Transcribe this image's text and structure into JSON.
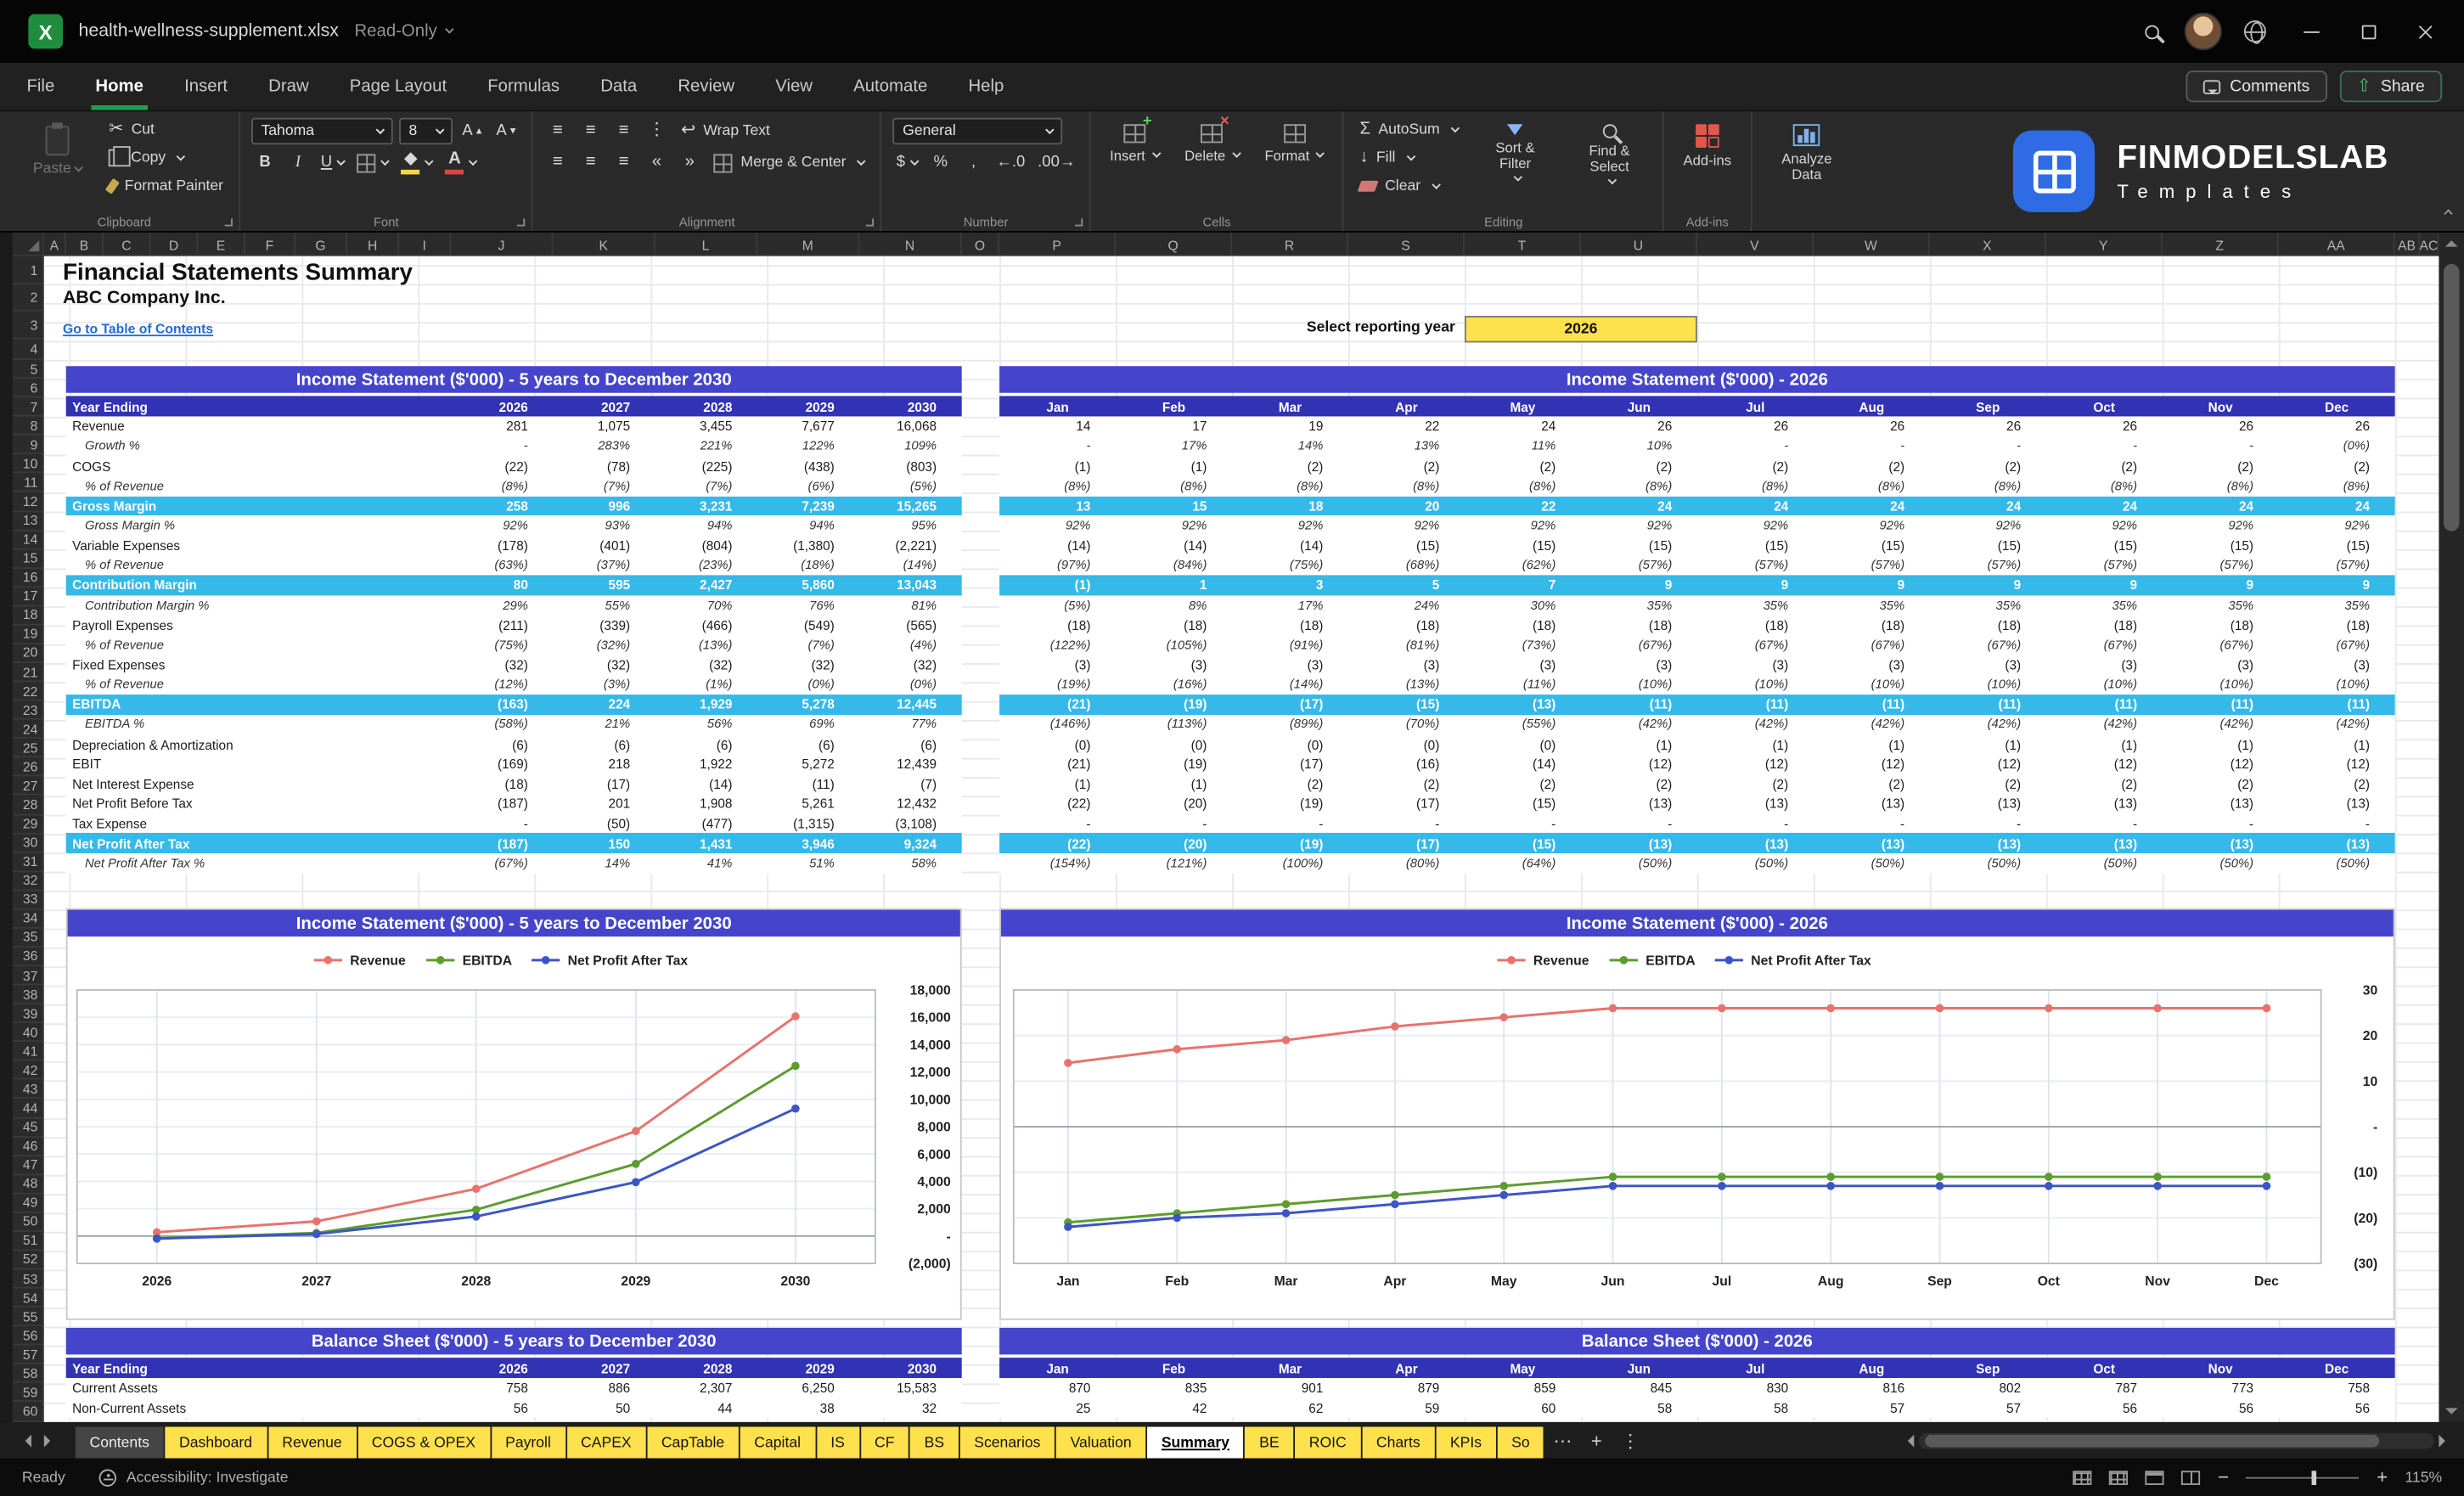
{
  "titlebar": {
    "filename": "health-wellness-supplement.xlsx",
    "mode": "Read-Only"
  },
  "menubar": {
    "items": [
      "File",
      "Home",
      "Insert",
      "Draw",
      "Page Layout",
      "Formulas",
      "Data",
      "Review",
      "View",
      "Automate",
      "Help"
    ],
    "active_item": "Home",
    "comments_label": "Comments",
    "share_label": "Share"
  },
  "ribbon": {
    "clipboard": {
      "label": "Clipboard",
      "paste": "Paste",
      "cut": "Cut",
      "copy": "Copy",
      "format_painter": "Format Painter"
    },
    "font": {
      "label": "Font",
      "font_name": "Tahoma",
      "font_size": "8"
    },
    "alignment": {
      "label": "Alignment",
      "wrap_text": "Wrap Text",
      "merge_center": "Merge & Center"
    },
    "number": {
      "label": "Number",
      "format": "General"
    },
    "cells": {
      "label": "Cells",
      "insert": "Insert",
      "delete": "Delete",
      "format": "Format"
    },
    "editing": {
      "label": "Editing",
      "autosum": "AutoSum",
      "fill": "Fill",
      "clear": "Clear",
      "sort_filter": "Sort & Filter",
      "find_select": "Find & Select"
    },
    "addins": {
      "label": "Add-ins",
      "button": "Add-ins"
    },
    "analyze": {
      "label": "Analyze Data"
    },
    "logo": {
      "line1": "FINMODELSLAB",
      "line2": "Templates"
    }
  },
  "grid": {
    "columns": [
      "A",
      "B",
      "C",
      "D",
      "E",
      "F",
      "G",
      "H",
      "I",
      "J",
      "K",
      "L",
      "M",
      "N",
      "O",
      "P",
      "Q",
      "R",
      "S",
      "T",
      "U",
      "V",
      "W",
      "X",
      "Y",
      "Z",
      "AA",
      "AB",
      "AC"
    ],
    "row_count": 60
  },
  "page": {
    "title": "Financial Statements Summary",
    "company": "ABC Company Inc.",
    "toc_link": "Go to Table of Contents",
    "reporting_year_label": "Select reporting year",
    "reporting_year": "2026"
  },
  "colors": {
    "accent_green": "#1f9e54",
    "header_bar": "#4545cb",
    "table_header": "#3232b4",
    "section_row": "#35b9e9",
    "tab_yellow": "#ffe14d",
    "link_blue": "#1f6bd8",
    "year_cell": "#ffe14d"
  },
  "income_statement": {
    "left_title": "Income Statement ($'000) - 5 years to December 2030",
    "right_title": "Income Statement ($'000) - 2026",
    "row_header": "Year Ending",
    "years": [
      "2026",
      "2027",
      "2028",
      "2029",
      "2030"
    ],
    "months": [
      "Jan",
      "Feb",
      "Mar",
      "Apr",
      "May",
      "Jun",
      "Jul",
      "Aug",
      "Sep",
      "Oct",
      "Nov",
      "Dec"
    ],
    "rows": [
      {
        "label": "Revenue",
        "style": "n",
        "years": [
          "281",
          "1,075",
          "3,455",
          "7,677",
          "16,068"
        ],
        "months": [
          "14",
          "17",
          "19",
          "22",
          "24",
          "26",
          "26",
          "26",
          "26",
          "26",
          "26",
          "26"
        ]
      },
      {
        "label": "Growth %",
        "style": "i",
        "years": [
          "-",
          "283%",
          "221%",
          "122%",
          "109%"
        ],
        "months": [
          "-",
          "17%",
          "14%",
          "13%",
          "11%",
          "10%",
          "-",
          "-",
          "-",
          "-",
          "-",
          "(0%)"
        ]
      },
      {
        "label": "COGS",
        "style": "n",
        "years": [
          "(22)",
          "(78)",
          "(225)",
          "(438)",
          "(803)"
        ],
        "months": [
          "(1)",
          "(1)",
          "(2)",
          "(2)",
          "(2)",
          "(2)",
          "(2)",
          "(2)",
          "(2)",
          "(2)",
          "(2)",
          "(2)"
        ]
      },
      {
        "label": "% of Revenue",
        "style": "i",
        "years": [
          "(8%)",
          "(7%)",
          "(7%)",
          "(6%)",
          "(5%)"
        ],
        "months": [
          "(8%)",
          "(8%)",
          "(8%)",
          "(8%)",
          "(8%)",
          "(8%)",
          "(8%)",
          "(8%)",
          "(8%)",
          "(8%)",
          "(8%)",
          "(8%)"
        ]
      },
      {
        "label": "Gross Margin",
        "style": "s",
        "years": [
          "258",
          "996",
          "3,231",
          "7,239",
          "15,265"
        ],
        "months": [
          "13",
          "15",
          "18",
          "20",
          "22",
          "24",
          "24",
          "24",
          "24",
          "24",
          "24",
          "24"
        ]
      },
      {
        "label": "Gross Margin %",
        "style": "i",
        "years": [
          "92%",
          "93%",
          "94%",
          "94%",
          "95%"
        ],
        "months": [
          "92%",
          "92%",
          "92%",
          "92%",
          "92%",
          "92%",
          "92%",
          "92%",
          "92%",
          "92%",
          "92%",
          "92%"
        ]
      },
      {
        "label": "Variable Expenses",
        "style": "n",
        "years": [
          "(178)",
          "(401)",
          "(804)",
          "(1,380)",
          "(2,221)"
        ],
        "months": [
          "(14)",
          "(14)",
          "(14)",
          "(15)",
          "(15)",
          "(15)",
          "(15)",
          "(15)",
          "(15)",
          "(15)",
          "(15)",
          "(15)"
        ]
      },
      {
        "label": "% of Revenue",
        "style": "i",
        "years": [
          "(63%)",
          "(37%)",
          "(23%)",
          "(18%)",
          "(14%)"
        ],
        "months": [
          "(97%)",
          "(84%)",
          "(75%)",
          "(68%)",
          "(62%)",
          "(57%)",
          "(57%)",
          "(57%)",
          "(57%)",
          "(57%)",
          "(57%)",
          "(57%)"
        ]
      },
      {
        "label": "Contribution Margin",
        "style": "s",
        "years": [
          "80",
          "595",
          "2,427",
          "5,860",
          "13,043"
        ],
        "months": [
          "(1)",
          "1",
          "3",
          "5",
          "7",
          "9",
          "9",
          "9",
          "9",
          "9",
          "9",
          "9"
        ]
      },
      {
        "label": "Contribution Margin %",
        "style": "i",
        "years": [
          "29%",
          "55%",
          "70%",
          "76%",
          "81%"
        ],
        "months": [
          "(5%)",
          "8%",
          "17%",
          "24%",
          "30%",
          "35%",
          "35%",
          "35%",
          "35%",
          "35%",
          "35%",
          "35%"
        ]
      },
      {
        "label": "Payroll Expenses",
        "style": "n",
        "years": [
          "(211)",
          "(339)",
          "(466)",
          "(549)",
          "(565)"
        ],
        "months": [
          "(18)",
          "(18)",
          "(18)",
          "(18)",
          "(18)",
          "(18)",
          "(18)",
          "(18)",
          "(18)",
          "(18)",
          "(18)",
          "(18)"
        ]
      },
      {
        "label": "% of Revenue",
        "style": "i",
        "years": [
          "(75%)",
          "(32%)",
          "(13%)",
          "(7%)",
          "(4%)"
        ],
        "months": [
          "(122%)",
          "(105%)",
          "(91%)",
          "(81%)",
          "(73%)",
          "(67%)",
          "(67%)",
          "(67%)",
          "(67%)",
          "(67%)",
          "(67%)",
          "(67%)"
        ]
      },
      {
        "label": "Fixed Expenses",
        "style": "n",
        "years": [
          "(32)",
          "(32)",
          "(32)",
          "(32)",
          "(32)"
        ],
        "months": [
          "(3)",
          "(3)",
          "(3)",
          "(3)",
          "(3)",
          "(3)",
          "(3)",
          "(3)",
          "(3)",
          "(3)",
          "(3)",
          "(3)"
        ]
      },
      {
        "label": "% of Revenue",
        "style": "i",
        "years": [
          "(12%)",
          "(3%)",
          "(1%)",
          "(0%)",
          "(0%)"
        ],
        "months": [
          "(19%)",
          "(16%)",
          "(14%)",
          "(13%)",
          "(11%)",
          "(10%)",
          "(10%)",
          "(10%)",
          "(10%)",
          "(10%)",
          "(10%)",
          "(10%)"
        ]
      },
      {
        "label": "EBITDA",
        "style": "s",
        "years": [
          "(163)",
          "224",
          "1,929",
          "5,278",
          "12,445"
        ],
        "months": [
          "(21)",
          "(19)",
          "(17)",
          "(15)",
          "(13)",
          "(11)",
          "(11)",
          "(11)",
          "(11)",
          "(11)",
          "(11)",
          "(11)"
        ]
      },
      {
        "label": "EBITDA %",
        "style": "i",
        "years": [
          "(58%)",
          "21%",
          "56%",
          "69%",
          "77%"
        ],
        "months": [
          "(146%)",
          "(113%)",
          "(89%)",
          "(70%)",
          "(55%)",
          "(42%)",
          "(42%)",
          "(42%)",
          "(42%)",
          "(42%)",
          "(42%)",
          "(42%)"
        ]
      },
      {
        "label": "Depreciation & Amortization",
        "style": "n",
        "years": [
          "(6)",
          "(6)",
          "(6)",
          "(6)",
          "(6)"
        ],
        "months": [
          "(0)",
          "(0)",
          "(0)",
          "(0)",
          "(0)",
          "(1)",
          "(1)",
          "(1)",
          "(1)",
          "(1)",
          "(1)",
          "(1)"
        ]
      },
      {
        "label": "EBIT",
        "style": "n",
        "years": [
          "(169)",
          "218",
          "1,922",
          "5,272",
          "12,439"
        ],
        "months": [
          "(21)",
          "(19)",
          "(17)",
          "(16)",
          "(14)",
          "(12)",
          "(12)",
          "(12)",
          "(12)",
          "(12)",
          "(12)",
          "(12)"
        ]
      },
      {
        "label": "Net Interest Expense",
        "style": "n",
        "years": [
          "(18)",
          "(17)",
          "(14)",
          "(11)",
          "(7)"
        ],
        "months": [
          "(1)",
          "(1)",
          "(2)",
          "(2)",
          "(2)",
          "(2)",
          "(2)",
          "(2)",
          "(2)",
          "(2)",
          "(2)",
          "(2)"
        ]
      },
      {
        "label": "Net Profit Before Tax",
        "style": "n",
        "years": [
          "(187)",
          "201",
          "1,908",
          "5,261",
          "12,432"
        ],
        "months": [
          "(22)",
          "(20)",
          "(19)",
          "(17)",
          "(15)",
          "(13)",
          "(13)",
          "(13)",
          "(13)",
          "(13)",
          "(13)",
          "(13)"
        ]
      },
      {
        "label": "Tax Expense",
        "style": "n",
        "years": [
          "-",
          "(50)",
          "(477)",
          "(1,315)",
          "(3,108)"
        ],
        "months": [
          "-",
          "-",
          "-",
          "-",
          "-",
          "-",
          "-",
          "-",
          "-",
          "-",
          "-",
          "-"
        ]
      },
      {
        "label": "Net Profit After Tax",
        "style": "s",
        "years": [
          "(187)",
          "150",
          "1,431",
          "3,946",
          "9,324"
        ],
        "months": [
          "(22)",
          "(20)",
          "(19)",
          "(17)",
          "(15)",
          "(13)",
          "(13)",
          "(13)",
          "(13)",
          "(13)",
          "(13)",
          "(13)"
        ]
      },
      {
        "label": "Net Profit After Tax %",
        "style": "i",
        "years": [
          "(67%)",
          "14%",
          "41%",
          "51%",
          "58%"
        ],
        "months": [
          "(154%)",
          "(121%)",
          "(100%)",
          "(80%)",
          "(64%)",
          "(50%)",
          "(50%)",
          "(50%)",
          "(50%)",
          "(50%)",
          "(50%)",
          "(50%)"
        ]
      }
    ]
  },
  "balance_sheet": {
    "left_title": "Balance Sheet ($'000) - 5 years to December 2030",
    "right_title": "Balance Sheet ($'000) - 2026",
    "row_header": "Year Ending",
    "rows": [
      {
        "label": "Current Assets",
        "style": "n",
        "years": [
          "758",
          "886",
          "2,307",
          "6,250",
          "15,583"
        ],
        "months": [
          "870",
          "835",
          "901",
          "879",
          "859",
          "845",
          "830",
          "816",
          "802",
          "787",
          "773",
          "758"
        ]
      },
      {
        "label": "Non-Current Assets",
        "style": "n",
        "years": [
          "56",
          "50",
          "44",
          "38",
          "32"
        ],
        "months": [
          "25",
          "42",
          "62",
          "59",
          "60",
          "58",
          "58",
          "57",
          "57",
          "56",
          "56",
          "56"
        ]
      }
    ]
  },
  "chart_data": [
    {
      "type": "line",
      "title": "Income Statement ($'000) - 5 years to December 2030",
      "x": [
        "2026",
        "2027",
        "2028",
        "2029",
        "2030"
      ],
      "series": [
        {
          "name": "Revenue",
          "color": "#e8736e",
          "values": [
            281,
            1075,
            3455,
            7677,
            16068
          ]
        },
        {
          "name": "EBITDA",
          "color": "#5e9c2f",
          "values": [
            -163,
            224,
            1929,
            5278,
            12445
          ]
        },
        {
          "name": "Net Profit After Tax",
          "color": "#3c55c6",
          "values": [
            -187,
            150,
            1431,
            3946,
            9324
          ]
        }
      ],
      "ylim": [
        -2000,
        18000
      ],
      "ytick_labels": [
        "18,000",
        "16,000",
        "14,000",
        "12,000",
        "10,000",
        "8,000",
        "6,000",
        "4,000",
        "2,000",
        "-",
        "(2,000)"
      ],
      "legend_position": "top",
      "axis_side": "right",
      "grid": true
    },
    {
      "type": "line",
      "title": "Income Statement ($'000) - 2026",
      "x": [
        "Jan",
        "Feb",
        "Mar",
        "Apr",
        "May",
        "Jun",
        "Jul",
        "Aug",
        "Sep",
        "Oct",
        "Nov",
        "Dec"
      ],
      "series": [
        {
          "name": "Revenue",
          "color": "#e8736e",
          "values": [
            14,
            17,
            19,
            22,
            24,
            26,
            26,
            26,
            26,
            26,
            26,
            26
          ]
        },
        {
          "name": "EBITDA",
          "color": "#5e9c2f",
          "values": [
            -21,
            -19,
            -17,
            -15,
            -13,
            -11,
            -11,
            -11,
            -11,
            -11,
            -11,
            -11
          ]
        },
        {
          "name": "Net Profit After Tax",
          "color": "#3c55c6",
          "values": [
            -22,
            -20,
            -19,
            -17,
            -15,
            -13,
            -13,
            -13,
            -13,
            -13,
            -13,
            -13
          ]
        }
      ],
      "ylim": [
        -30,
        30
      ],
      "ytick_labels": [
        "30",
        "20",
        "10",
        "-",
        "(10)",
        "(20)",
        "(30)"
      ],
      "legend_position": "top",
      "axis_side": "right",
      "grid": true
    }
  ],
  "sheet_tabs": {
    "tabs": [
      {
        "label": "Contents",
        "style": "dark"
      },
      {
        "label": "Dashboard",
        "style": "yellow"
      },
      {
        "label": "Revenue",
        "style": "yellow"
      },
      {
        "label": "COGS & OPEX",
        "style": "yellow"
      },
      {
        "label": "Payroll",
        "style": "yellow"
      },
      {
        "label": "CAPEX",
        "style": "yellow"
      },
      {
        "label": "CapTable",
        "style": "yellow"
      },
      {
        "label": "Capital",
        "style": "yellow"
      },
      {
        "label": "IS",
        "style": "yellow"
      },
      {
        "label": "CF",
        "style": "yellow"
      },
      {
        "label": "BS",
        "style": "yellow"
      },
      {
        "label": "Scenarios",
        "style": "yellow"
      },
      {
        "label": "Valuation",
        "style": "yellow"
      },
      {
        "label": "Summary",
        "style": "active"
      },
      {
        "label": "BE",
        "style": "yellow"
      },
      {
        "label": "ROIC",
        "style": "yellow"
      },
      {
        "label": "Charts",
        "style": "yellow"
      },
      {
        "label": "KPIs",
        "style": "yellow"
      },
      {
        "label": "So",
        "style": "yellow"
      }
    ]
  },
  "statusbar": {
    "ready": "Ready",
    "accessibility": "Accessibility: Investigate",
    "zoom": "115%"
  }
}
